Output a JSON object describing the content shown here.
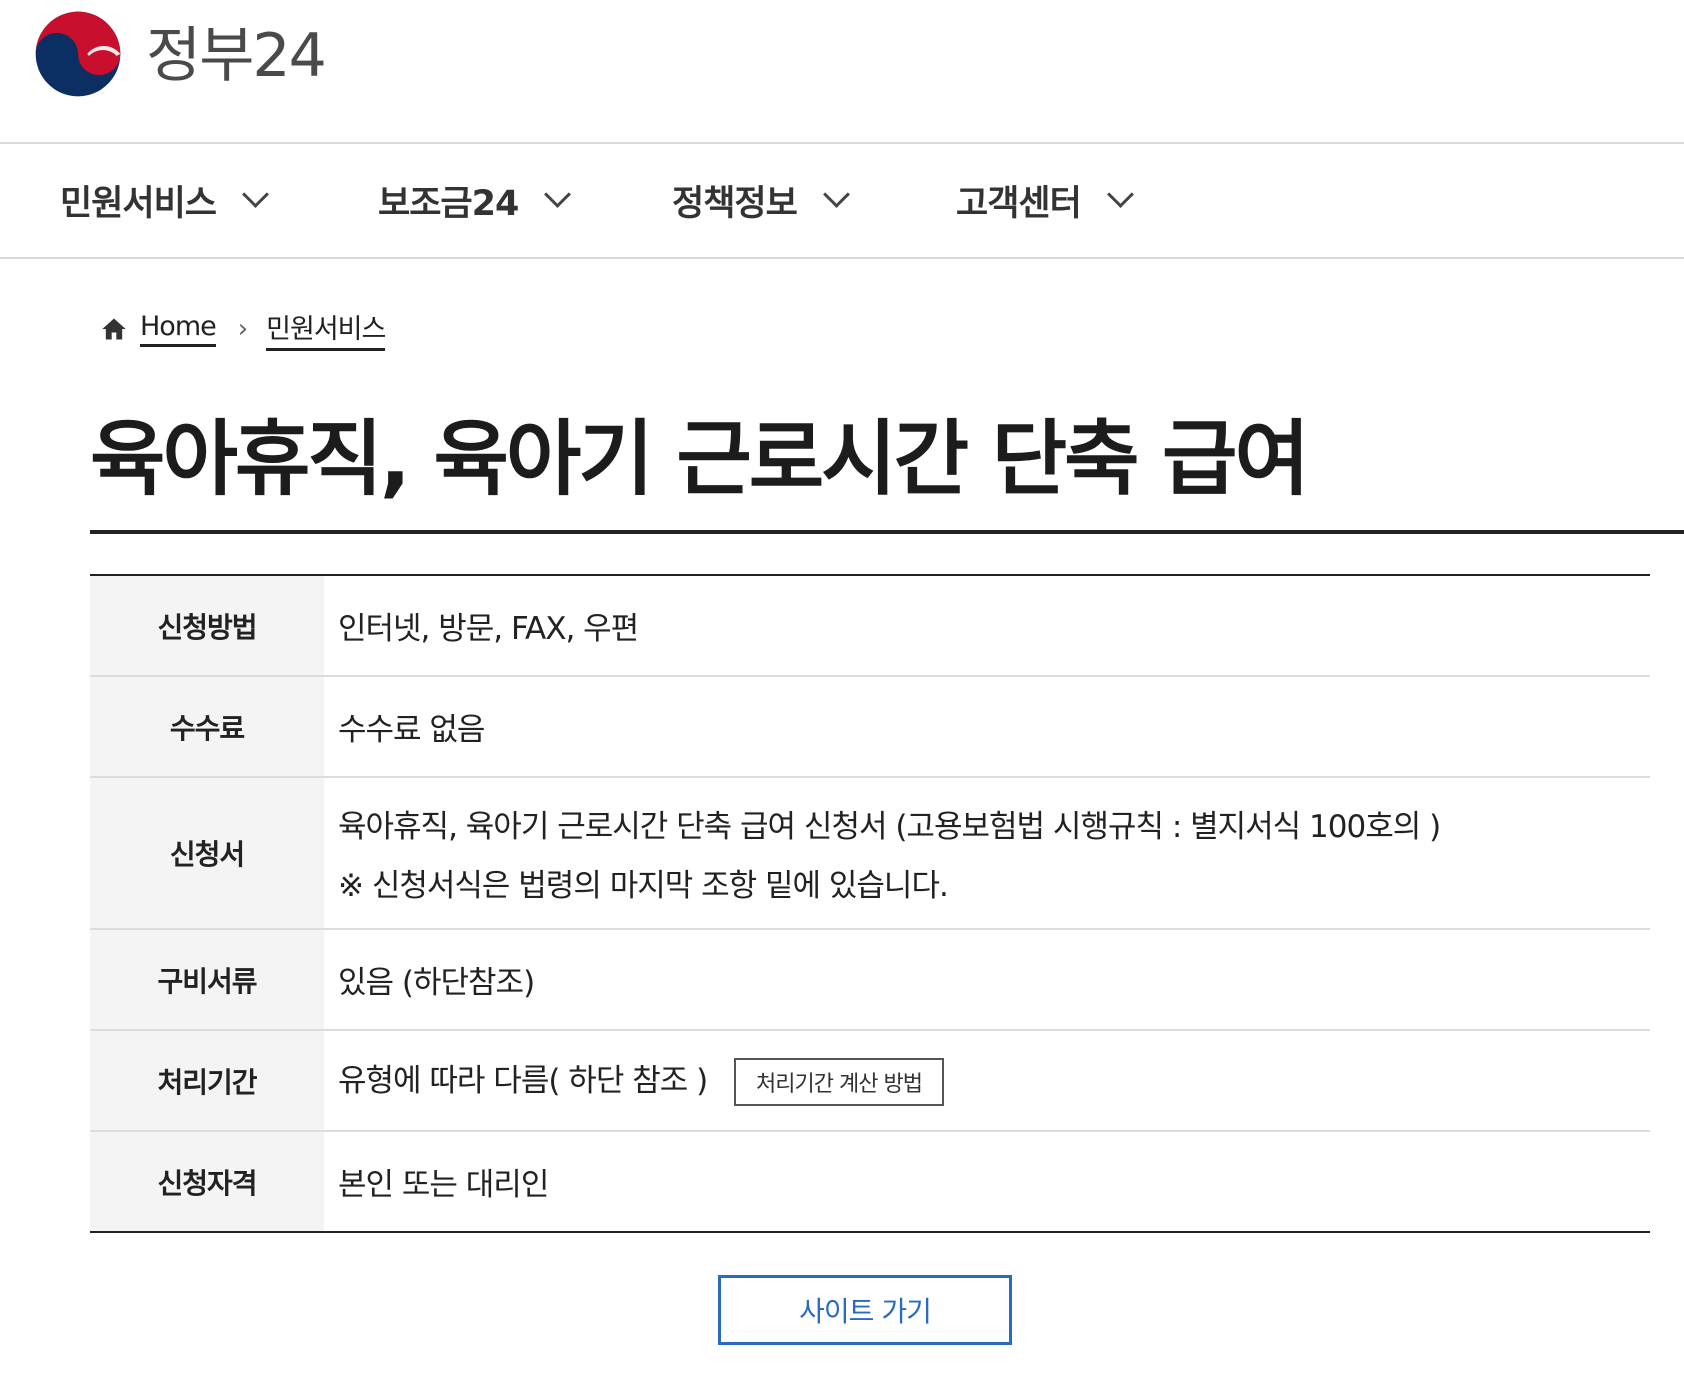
{
  "site": {
    "brand_name": "정부24",
    "logo_icon": "korea-taegeuk-logo-icon",
    "colors": {
      "primary_blue": "#2a6bbf",
      "logo_red": "#c8102e",
      "logo_navy": "#0b2f63"
    }
  },
  "gnb": {
    "items": [
      {
        "label": "민원서비스",
        "icon": "chevron-down-icon"
      },
      {
        "label": "보조금24",
        "icon": "chevron-down-icon"
      },
      {
        "label": "정책정보",
        "icon": "chevron-down-icon"
      },
      {
        "label": "고객센터",
        "icon": "chevron-down-icon"
      }
    ]
  },
  "breadcrumb": {
    "home_icon": "home-icon",
    "home_label": "Home",
    "current_label": "민원서비스"
  },
  "page": {
    "title": "육아휴직, 육아기 근로시간 단축 급여"
  },
  "info_table": {
    "rows": [
      {
        "label": "신청방법",
        "value": "인터넷, 방문, FAX, 우편"
      },
      {
        "label": "수수료",
        "value": "수수료 없음"
      },
      {
        "label": "신청서",
        "value": "육아휴직, 육아기 근로시간 단축 급여 신청서 (고용보험법 시행규칙 : 별지서식 100호의 )",
        "value_line2": "※ 신청서식은 법령의 마지막 조항 밑에 있습니다."
      },
      {
        "label": "구비서류",
        "value": "있음 (하단참조)"
      },
      {
        "label": "처리기간",
        "value": "유형에 따라 다름( 하단 참조 )",
        "button_label": "처리기간 계산 방법"
      },
      {
        "label": "신청자격",
        "value": "본인 또는 대리인"
      }
    ]
  },
  "actions": {
    "site_button_label": "사이트 가기"
  }
}
